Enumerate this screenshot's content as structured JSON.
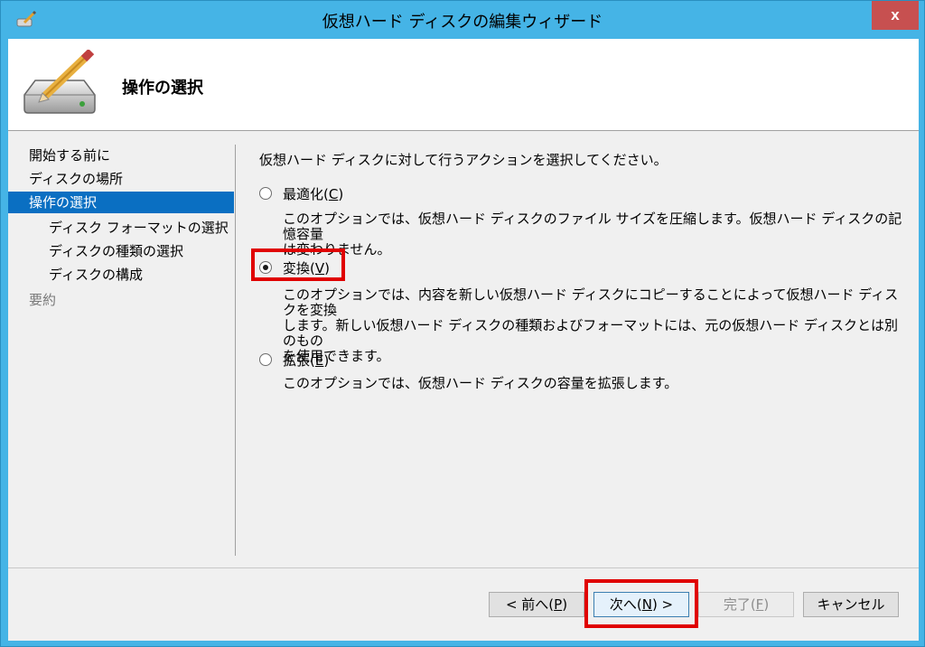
{
  "window": {
    "title": "仮想ハード ディスクの編集ウィザード",
    "close_label": "x"
  },
  "header": {
    "title": "操作の選択",
    "icon": "disk-pencil-icon"
  },
  "nav": {
    "items": [
      {
        "label": "開始する前に",
        "state": "normal"
      },
      {
        "label": "ディスクの場所",
        "state": "normal"
      },
      {
        "label": "操作の選択",
        "state": "active"
      },
      {
        "label": "ディスク フォーマットの選択",
        "state": "sub"
      },
      {
        "label": "ディスクの種類の選択",
        "state": "sub"
      },
      {
        "label": "ディスクの構成",
        "state": "sub"
      },
      {
        "label": "要約",
        "state": "disabled"
      }
    ]
  },
  "content": {
    "instruction": "仮想ハード ディスクに対して行うアクションを選択してください。",
    "options": [
      {
        "label": "最適化",
        "mnemonic": "C",
        "checked": false,
        "desc_line1": "このオプションでは、仮想ハード ディスクのファイル サイズを圧縮します。仮想ハード ディスクの記憶容量",
        "desc_line2": "は変わりません。"
      },
      {
        "label": "変換",
        "mnemonic": "V",
        "checked": true,
        "desc_line1": "このオプションでは、内容を新しい仮想ハード ディスクにコピーすることによって仮想ハード ディスクを変換",
        "desc_line2": "します。新しい仮想ハード ディスクの種類およびフォーマットには、元の仮想ハード ディスクとは別のもの",
        "desc_line3": "を使用できます。"
      },
      {
        "label": "拡張",
        "mnemonic": "E",
        "checked": false,
        "desc_line1": "このオプションでは、仮想ハード ディスクの容量を拡張します。"
      }
    ]
  },
  "buttons": {
    "back": {
      "pre": "< 前へ(",
      "mn": "P",
      "post": ")"
    },
    "next": {
      "pre": "次へ(",
      "mn": "N",
      "post": ") >"
    },
    "finish": {
      "pre": "完了(",
      "mn": "F",
      "post": ")"
    },
    "cancel": "キャンセル"
  },
  "colors": {
    "titlebar": "#45b4e6",
    "nav_active": "#0a6fc2",
    "highlight": "#e00000"
  }
}
